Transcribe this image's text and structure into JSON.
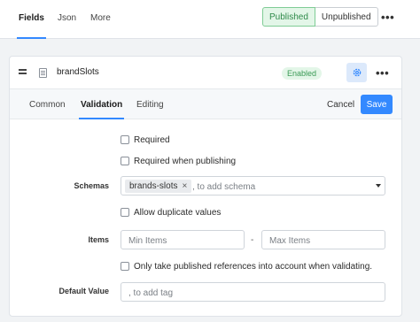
{
  "top_tabs": [
    {
      "label": "Fields"
    },
    {
      "label": "Json"
    },
    {
      "label": "More"
    }
  ],
  "status": {
    "published": "Published",
    "unpublished": "Unpublished"
  },
  "menu_dots": "•••",
  "field": {
    "name": "brandSlots",
    "badge": "Enabled"
  },
  "sub_tabs": [
    {
      "label": "Common"
    },
    {
      "label": "Validation"
    },
    {
      "label": "Editing"
    }
  ],
  "actions": {
    "cancel": "Cancel",
    "save": "Save"
  },
  "validation": {
    "required_label": "Required",
    "required_publishing_label": "Required when publishing",
    "schemas_label": "Schemas",
    "schemas_tag": "brands-slots",
    "schemas_tag_remove": "×",
    "schemas_placeholder": ", to add schema",
    "allow_duplicates_label": "Allow duplicate values",
    "items_label": "Items",
    "min_items_placeholder": "Min Items",
    "items_separator": "-",
    "max_items_placeholder": "Max Items",
    "published_refs_label": "Only take published references into account when validating.",
    "default_value_label": "Default Value",
    "default_value_placeholder": ", to add tag"
  },
  "colors": {
    "accent": "#3389ff",
    "success": "#3a9a55",
    "success_bg": "#e3f6e8"
  }
}
